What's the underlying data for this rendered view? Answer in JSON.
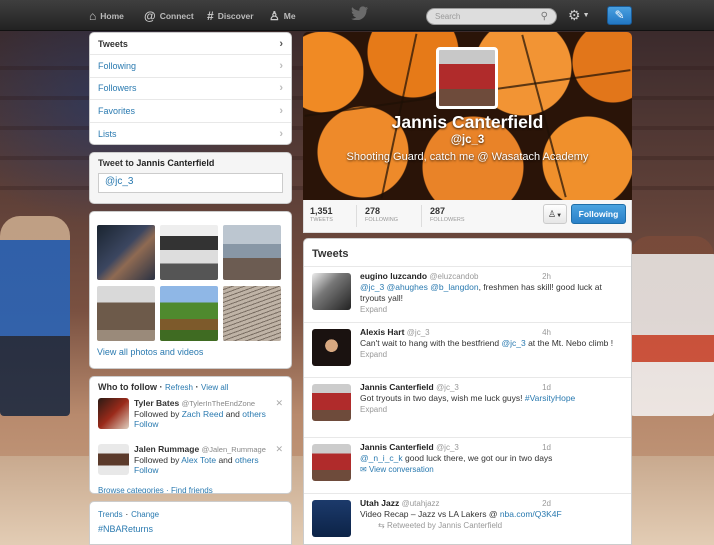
{
  "nav": {
    "home": "Home",
    "connect": "Connect",
    "discover": "Discover",
    "me": "Me",
    "search_placeholder": "Search"
  },
  "sidebar": {
    "items": [
      {
        "label": "Tweets"
      },
      {
        "label": "Following"
      },
      {
        "label": "Followers"
      },
      {
        "label": "Favorites"
      },
      {
        "label": "Lists"
      }
    ]
  },
  "tweet_to": {
    "prefix": "Tweet to",
    "name": "Jannis Canterfield",
    "value": "@jc_3"
  },
  "photos": {
    "view_all": "View all photos and videos"
  },
  "who_to_follow": {
    "title": "Who to follow",
    "refresh": "Refresh",
    "view_all": "View all",
    "suggestions": [
      {
        "name": "Tyler Bates",
        "handle": "@TylerInTheEndZone",
        "followed_by_prefix": "Followed by",
        "followed_by": "Zach Reed",
        "and": "and",
        "others": "others",
        "follow": "Follow"
      },
      {
        "name": "Jalen Rummage",
        "handle": "@Jalen_Rummage",
        "followed_by_prefix": "Followed by",
        "followed_by": "Alex Tote",
        "and": "and",
        "others": "others",
        "follow": "Follow"
      }
    ],
    "browse": "Browse categories",
    "sep": "·",
    "find_friends": "Find friends"
  },
  "trends": {
    "title": "Trends",
    "change": "Change",
    "items": [
      "#NBAReturns"
    ]
  },
  "profile": {
    "name": "Jannis Canterfield",
    "handle": "@jc_3",
    "bio": "Shooting Guard, catch me @ Wasatach Academy",
    "tweets_count": "1,351",
    "tweets_label": "TWEETS",
    "following_count": "278",
    "following_label": "FOLLOWING",
    "followers_count": "287",
    "followers_label": "FOLLOWERS",
    "follow_button": "Following"
  },
  "timeline": {
    "title": "Tweets",
    "tweets": [
      {
        "name": "eugino luzcando",
        "handle": "@eluzcandob",
        "time": "2h",
        "parts": [
          "@jc_3",
          " ",
          "@ahughes",
          " ",
          "@b_langdon",
          ", freshmen has skill! good luck at tryouts yall!"
        ],
        "action": "Expand"
      },
      {
        "name": "Alexis Hart",
        "handle": "@jc_3",
        "time": "4h",
        "text_a": "Can't wait to hang with the bestfriend ",
        "mention": "@jc_3",
        "text_b": " at the Mt. Nebo climb !",
        "action": "Expand"
      },
      {
        "name": "Jannis Canterfield",
        "handle": "@jc_3",
        "time": "1d",
        "text_a": "Got tryouts in two days, wish me luck guys! ",
        "hashtag": "#VarsityHope",
        "action": "Expand"
      },
      {
        "name": "Jannis Canterfield",
        "handle": "@jc_3",
        "time": "1d",
        "mention": "@_n_i_c_k",
        "text_b": " good luck there, we got our in two days",
        "action": "View conversation"
      },
      {
        "name": "Utah Jazz",
        "handle": "@utahjazz",
        "time": "2d",
        "text_a": "Video Recap – Jazz vs LA Lakers @ ",
        "link": "nba.com/Q3K4F",
        "retweeted": "Retweeted by Jannis Canterfield"
      }
    ]
  }
}
